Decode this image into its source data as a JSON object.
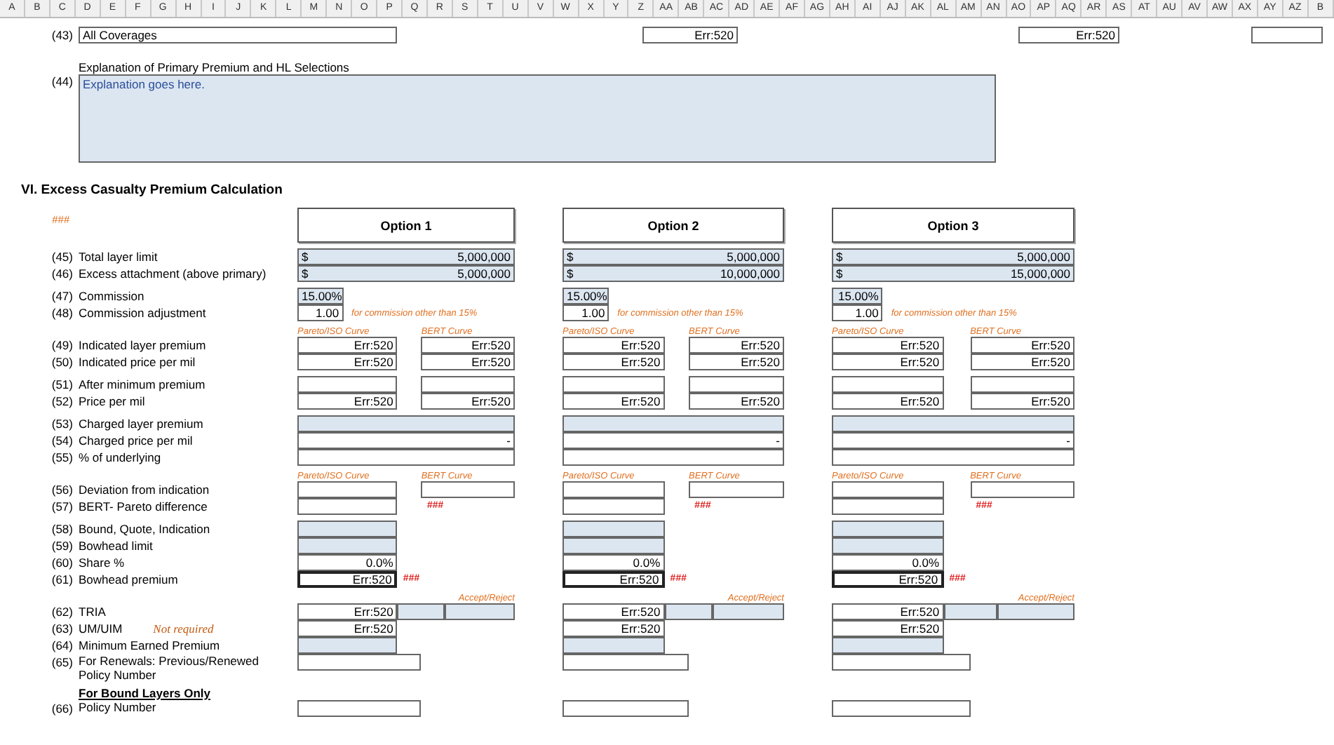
{
  "column_headers": [
    "A",
    "B",
    "C",
    "D",
    "E",
    "F",
    "G",
    "H",
    "I",
    "J",
    "K",
    "L",
    "M",
    "N",
    "O",
    "P",
    "Q",
    "R",
    "S",
    "T",
    "U",
    "V",
    "W",
    "X",
    "Y",
    "Z",
    "AA",
    "AB",
    "AC",
    "AD",
    "AE",
    "AF",
    "AG",
    "AH",
    "AI",
    "AJ",
    "AK",
    "AL",
    "AM",
    "AN",
    "AO",
    "AP",
    "AQ",
    "AR",
    "AS",
    "AT",
    "AU",
    "AV",
    "AW",
    "AX",
    "AY",
    "AZ",
    "B"
  ],
  "top_row": {
    "number": "(43)",
    "label": "All Coverages",
    "values": [
      "Err:520",
      "Err:520"
    ]
  },
  "explanation": {
    "heading": "Explanation of Primary Premium and HL Selections",
    "number": "(44)",
    "value": "Explanation goes here."
  },
  "section": {
    "title": "VI. Excess Casualty Premium Calculation",
    "marker": "###",
    "options": [
      "Option 1",
      "Option 2",
      "Option 3"
    ],
    "groups": [
      {
        "rows": [
          {
            "number": "(45)",
            "label": "Total layer limit",
            "kind": "money",
            "cells": [
              {
                "currency": "$",
                "value": "5,000,000"
              },
              {
                "currency": "$",
                "value": "5,000,000"
              },
              {
                "currency": "$",
                "value": "5,000,000"
              }
            ]
          },
          {
            "number": "(46)",
            "label": "Excess attachment (above primary)",
            "kind": "money",
            "cells": [
              {
                "currency": "$",
                "value": "5,000,000"
              },
              {
                "currency": "$",
                "value": "10,000,000"
              },
              {
                "currency": "$",
                "value": "15,000,000"
              }
            ]
          }
        ]
      },
      {
        "rows": [
          {
            "number": "(47)",
            "label": "Commission",
            "kind": "commission",
            "cells": [
              {
                "value": "15.00%"
              },
              {
                "value": "15.00%"
              },
              {
                "value": "15.00%"
              }
            ]
          },
          {
            "number": "(48)",
            "label": "Commission adjustment",
            "kind": "adjustment",
            "cells": [
              {
                "value": "1.00",
                "note": "for commission other than 15%"
              },
              {
                "value": "1.00",
                "note": "for commission other than 15%"
              },
              {
                "value": "1.00",
                "note": "for commission other than 15%"
              }
            ]
          }
        ]
      },
      {
        "rows": [
          {
            "kind": "curve_labels",
            "cells": [
              {
                "pareto": "Pareto/ISO Curve",
                "bert": "BERT Curve"
              },
              {
                "pareto": "Pareto/ISO Curve",
                "bert": "BERT Curve"
              },
              {
                "pareto": "Pareto/ISO Curve",
                "bert": "BERT Curve"
              }
            ]
          },
          {
            "number": "(49)",
            "label": "Indicated layer premium",
            "kind": "pair",
            "cells": [
              {
                "pareto": "Err:520",
                "bert": "Err:520"
              },
              {
                "pareto": "Err:520",
                "bert": "Err:520"
              },
              {
                "pareto": "Err:520",
                "bert": "Err:520"
              }
            ]
          },
          {
            "number": "(50)",
            "label": "Indicated price per mil",
            "kind": "pair",
            "cells": [
              {
                "pareto": "Err:520",
                "bert": "Err:520"
              },
              {
                "pareto": "Err:520",
                "bert": "Err:520"
              },
              {
                "pareto": "Err:520",
                "bert": "Err:520"
              }
            ]
          }
        ]
      },
      {
        "rows": [
          {
            "number": "(51)",
            "label": "After minimum premium",
            "kind": "pair",
            "cells": [
              {},
              {},
              {}
            ]
          },
          {
            "number": "(52)",
            "label": "Price per mil",
            "kind": "pair",
            "cells": [
              {
                "pareto": "Err:520",
                "bert": "Err:520"
              },
              {
                "pareto": "Err:520",
                "bert": "Err:520"
              },
              {
                "pareto": "Err:520",
                "bert": "Err:520"
              }
            ]
          }
        ]
      },
      {
        "rows": [
          {
            "number": "(53)",
            "label": "Charged layer premium",
            "kind": "wide",
            "cells": [
              {
                "shaded": true
              },
              {
                "shaded": true
              },
              {
                "shaded": true
              }
            ]
          },
          {
            "number": "(54)",
            "label": "Charged price per mil",
            "kind": "wide",
            "cells": [
              {
                "shaded": false,
                "value": "-"
              },
              {
                "shaded": false,
                "value": "-"
              },
              {
                "shaded": false,
                "value": "-"
              }
            ]
          },
          {
            "number": "(55)",
            "label": "% of underlying",
            "kind": "wide",
            "cells": [
              {
                "shaded": false
              },
              {
                "shaded": false
              },
              {
                "shaded": false
              }
            ]
          }
        ]
      },
      {
        "rows": [
          {
            "kind": "curve_labels",
            "cells": [
              {
                "pareto": "Pareto/ISO Curve",
                "bert": "BERT Curve"
              },
              {
                "pareto": "Pareto/ISO Curve",
                "bert": "BERT Curve"
              },
              {
                "pareto": "Pareto/ISO Curve",
                "bert": "BERT Curve"
              }
            ]
          },
          {
            "number": "(56)",
            "label": "Deviation from indication",
            "kind": "pair",
            "cells": [
              {},
              {},
              {}
            ]
          },
          {
            "number": "(57)",
            "label": "BERT- Pareto difference",
            "kind": "pareto_flag",
            "cells": [
              {
                "flag": "###"
              },
              {
                "flag": "###"
              },
              {
                "flag": "###"
              }
            ]
          }
        ]
      },
      {
        "rows": [
          {
            "number": "(58)",
            "label": "Bound, Quote, Indication",
            "kind": "narrow",
            "cells": [
              {
                "shaded": true,
                "bold_border": false
              },
              {
                "shaded": true,
                "bold_border": false
              },
              {
                "shaded": true,
                "bold_border": false
              }
            ]
          },
          {
            "number": "(59)",
            "label": "Bowhead limit",
            "kind": "narrow",
            "cells": [
              {
                "shaded": true,
                "bold_border": false
              },
              {
                "shaded": true,
                "bold_border": false
              },
              {
                "shaded": true,
                "bold_border": false
              }
            ]
          },
          {
            "number": "(60)",
            "label": "Share %",
            "kind": "narrow",
            "cells": [
              {
                "shaded": false,
                "bold_border": false,
                "value": "0.0%"
              },
              {
                "shaded": false,
                "bold_border": false,
                "value": "0.0%"
              },
              {
                "shaded": false,
                "bold_border": false,
                "value": "0.0%"
              }
            ]
          },
          {
            "number": "(61)",
            "label": "Bowhead premium",
            "kind": "narrow",
            "cells": [
              {
                "shaded": false,
                "bold_border": true,
                "value": "Err:520",
                "flag": "###"
              },
              {
                "shaded": false,
                "bold_border": true,
                "value": "Err:520",
                "flag": "###"
              },
              {
                "shaded": false,
                "bold_border": true,
                "value": "Err:520",
                "flag": "###"
              }
            ]
          }
        ]
      },
      {
        "rows": [
          {
            "kind": "accept_label",
            "cells": [
              {
                "label": "Accept/Reject"
              },
              {
                "label": "Accept/Reject"
              },
              {
                "label": "Accept/Reject"
              }
            ]
          },
          {
            "number": "(62)",
            "label": "TRIA",
            "kind": "tria",
            "cells": [
              {
                "value": "Err:520"
              },
              {
                "value": "Err:520"
              },
              {
                "value": "Err:520"
              }
            ]
          },
          {
            "number": "(63)",
            "label": "UM/UIM",
            "note": "Not required",
            "kind": "narrow",
            "cells": [
              {
                "shaded": false,
                "bold_border": false,
                "value": "Err:520"
              },
              {
                "shaded": false,
                "bold_border": false,
                "value": "Err:520"
              },
              {
                "shaded": false,
                "bold_border": false,
                "value": "Err:520"
              }
            ]
          },
          {
            "number": "(64)",
            "label": "Minimum Earned Premium",
            "kind": "narrow",
            "cells": [
              {
                "shaded": true,
                "bold_border": false
              },
              {
                "shaded": true,
                "bold_border": false
              },
              {
                "shaded": true,
                "bold_border": false
              }
            ]
          },
          {
            "number": "(65)",
            "label": "For Renewals: Previous/Renewed Policy Number",
            "kind": "medium",
            "cells": [
              {},
              {},
              {}
            ]
          }
        ]
      }
    ]
  },
  "bound": {
    "heading": "For Bound Layers Only",
    "rows": [
      {
        "number": "(66)",
        "label": "Policy Number",
        "kind": "medium",
        "cells": [
          {},
          {},
          {}
        ]
      }
    ]
  }
}
